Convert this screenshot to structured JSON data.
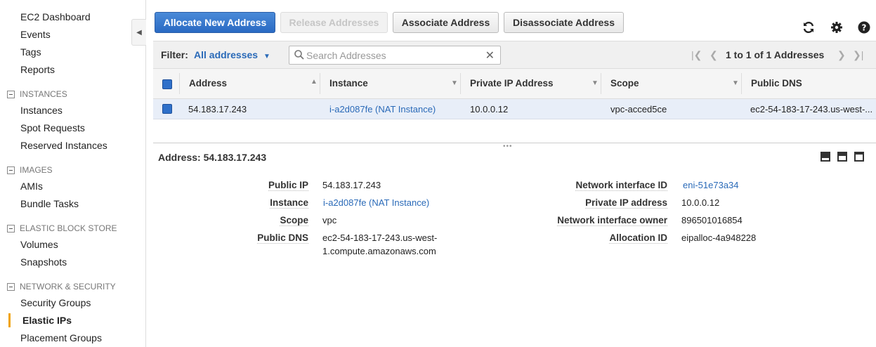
{
  "sidebar": {
    "items": {
      "ec2_dashboard": "EC2 Dashboard",
      "events": "Events",
      "tags": "Tags",
      "reports": "Reports",
      "instances": "Instances",
      "spot_requests": "Spot Requests",
      "reserved_instances": "Reserved Instances",
      "amis": "AMIs",
      "bundle_tasks": "Bundle Tasks",
      "volumes": "Volumes",
      "snapshots": "Snapshots",
      "security_groups": "Security Groups",
      "elastic_ips": "Elastic IPs",
      "placement_groups": "Placement Groups"
    },
    "sections": {
      "instances": "INSTANCES",
      "images": "IMAGES",
      "ebs": "ELASTIC BLOCK STORE",
      "network": "NETWORK & SECURITY"
    },
    "active_item": "Elastic IPs",
    "active_color": "#f0a30a"
  },
  "toolbar": {
    "allocate": "Allocate New Address",
    "release": "Release Addresses",
    "associate": "Associate Address",
    "disassociate": "Disassociate Address"
  },
  "top_icons": [
    "refresh-icon",
    "gear-icon",
    "help-icon"
  ],
  "filter": {
    "label": "Filter:",
    "selected": "All addresses",
    "search_placeholder": "Search Addresses",
    "pagination": "1 to 1 of 1 Addresses"
  },
  "table": {
    "columns": {
      "address": "Address",
      "instance": "Instance",
      "private_ip": "Private IP Address",
      "scope": "Scope",
      "public_dns": "Public DNS"
    },
    "rows": [
      {
        "address": "54.183.17.243",
        "instance": "i-a2d087fe (NAT Instance)",
        "private_ip": "10.0.0.12",
        "scope": "vpc-acced5ce",
        "public_dns": "ec2-54-183-17-243.us-west-..."
      }
    ]
  },
  "detail": {
    "title": "Address: 54.183.17.243",
    "labels": {
      "public_ip": "Public IP",
      "instance": "Instance",
      "scope": "Scope",
      "public_dns": "Public DNS",
      "eni_id": "Network interface ID",
      "private_ip": "Private IP address",
      "eni_owner": "Network interface owner",
      "allocation_id": "Allocation ID"
    },
    "values": {
      "public_ip": "54.183.17.243",
      "instance": "i-a2d087fe (NAT Instance)",
      "scope": "vpc",
      "public_dns_line1": "ec2-54-183-17-243.us-west-",
      "public_dns_line2": "1.compute.amazonaws.com",
      "eni_id": "eni-51e73a34",
      "private_ip": "10.0.0.12",
      "eni_owner": "896501016854",
      "allocation_id": "eipalloc-4a948228"
    }
  },
  "colors": {
    "primary": "#2a6ac3",
    "link": "#2a6ab8",
    "selected_row": "#e8eef8"
  }
}
